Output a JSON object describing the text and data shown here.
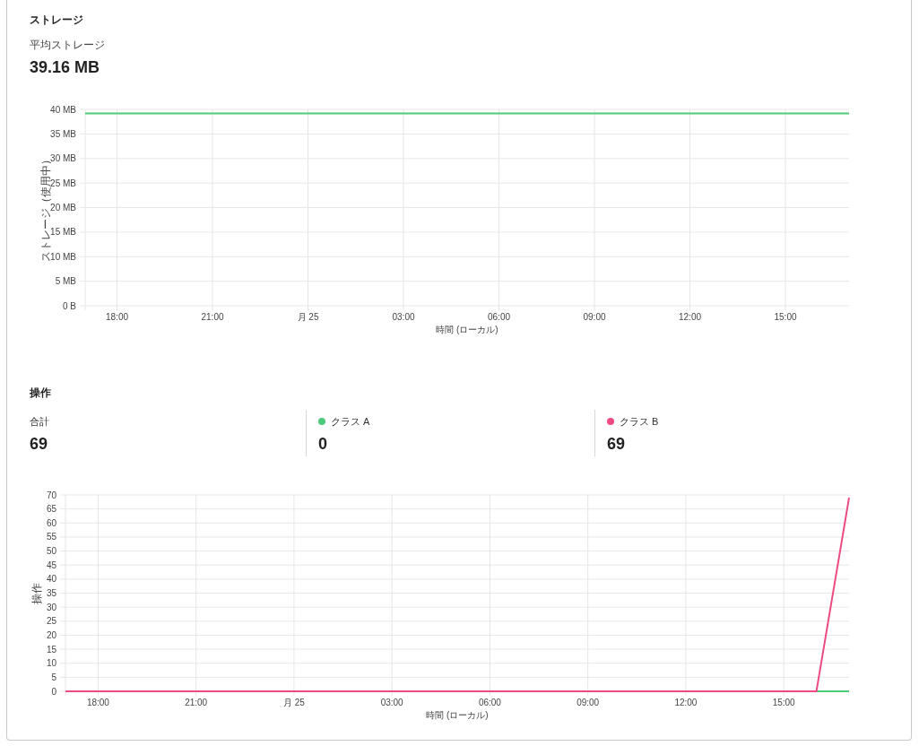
{
  "storage": {
    "title": "ストレージ",
    "metric_label": "平均ストレージ",
    "metric_value": "39.16 MB",
    "chart_data": {
      "type": "line",
      "xlabel": "時間 (ローカル)",
      "ylabel": "ストレージ（使用中）",
      "categories": [
        null,
        "18:00",
        null,
        null,
        "21:00",
        null,
        null,
        "月 25",
        null,
        null,
        "03:00",
        null,
        null,
        "06:00",
        null,
        null,
        "09:00",
        null,
        null,
        "12:00",
        null,
        null,
        "15:00",
        null,
        null
      ],
      "series": [
        {
          "color": "#4cc97a",
          "values": [
            39.2,
            39.2,
            39.2,
            39.2,
            39.2,
            39.2,
            39.2,
            39.2,
            39.2,
            39.2,
            39.2,
            39.2,
            39.2,
            39.2,
            39.2,
            39.2,
            39.2,
            39.2,
            39.2,
            39.2,
            39.2,
            39.2,
            39.2,
            39.2,
            39.2
          ]
        }
      ],
      "ylim": [
        0,
        40
      ],
      "grid": true,
      "yticks": [
        {
          "value": 0,
          "label": "0 B"
        },
        {
          "value": 5,
          "label": "5 MB"
        },
        {
          "value": 10,
          "label": "10 MB"
        },
        {
          "value": 15,
          "label": "15 MB"
        },
        {
          "value": 20,
          "label": "20 MB"
        },
        {
          "value": 25,
          "label": "25 MB"
        },
        {
          "value": 30,
          "label": "30 MB"
        },
        {
          "value": 35,
          "label": "35 MB"
        },
        {
          "value": 40,
          "label": "40 MB"
        }
      ]
    }
  },
  "operations": {
    "title": "操作",
    "stats": [
      {
        "label": "合計",
        "value": "69"
      },
      {
        "label": "クラス A",
        "value": "0",
        "color": "#4cc97a"
      },
      {
        "label": "クラス B",
        "value": "69",
        "color": "#ee4a82"
      }
    ],
    "chart_data": {
      "type": "line",
      "xlabel": "時間 (ローカル)",
      "ylabel": "操作",
      "categories": [
        null,
        "18:00",
        null,
        null,
        "21:00",
        null,
        null,
        "月 25",
        null,
        null,
        "03:00",
        null,
        null,
        "06:00",
        null,
        null,
        "09:00",
        null,
        null,
        "12:00",
        null,
        null,
        "15:00",
        null,
        null
      ],
      "series": [
        {
          "color": "#4cc97a",
          "values": [
            null,
            null,
            null,
            null,
            null,
            null,
            null,
            null,
            null,
            null,
            null,
            null,
            null,
            null,
            null,
            null,
            null,
            null,
            null,
            null,
            null,
            null,
            null,
            0,
            0
          ]
        },
        {
          "color": "#ee4a82",
          "values": [
            0,
            0,
            0,
            0,
            0,
            0,
            0,
            0,
            0,
            0,
            0,
            0,
            0,
            0,
            0,
            0,
            0,
            0,
            0,
            0,
            0,
            0,
            0,
            0,
            69
          ]
        }
      ],
      "ylim": [
        0,
        70
      ],
      "grid": true,
      "yticks": [
        0,
        5,
        10,
        15,
        20,
        25,
        30,
        35,
        40,
        45,
        50,
        55,
        60,
        65,
        70
      ]
    }
  }
}
